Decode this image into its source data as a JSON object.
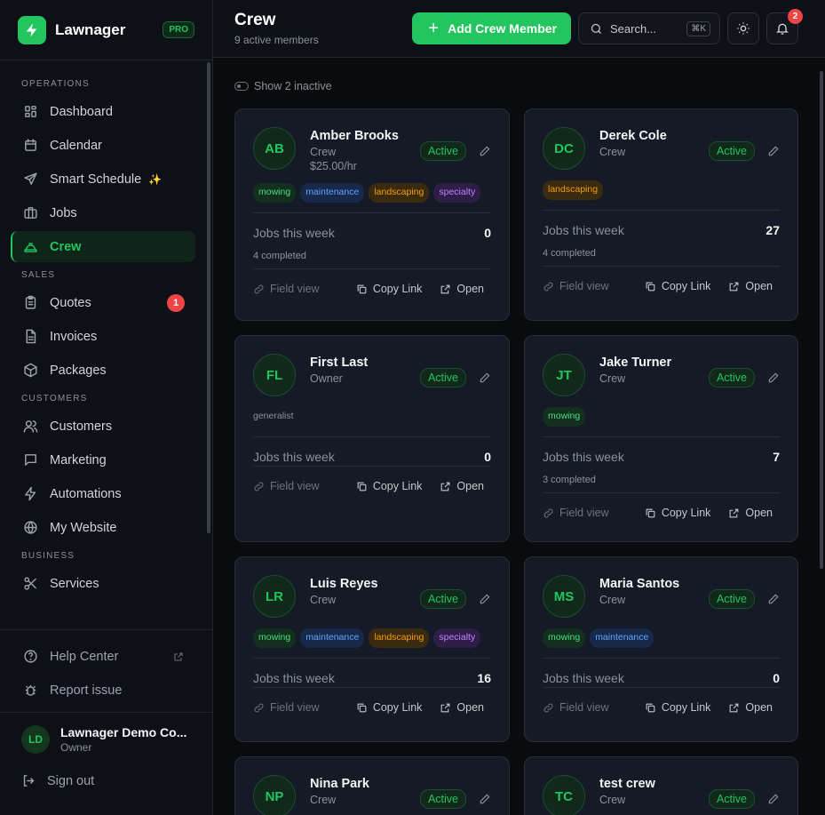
{
  "brand": {
    "name": "Lawnager",
    "badge": "PRO"
  },
  "sidebar": {
    "sections": [
      {
        "label": "OPERATIONS",
        "items": [
          {
            "label": "Dashboard",
            "icon": "grid-icon"
          },
          {
            "label": "Calendar",
            "icon": "calendar-icon"
          },
          {
            "label": "Smart Schedule",
            "icon": "send-icon",
            "sparkle": "✨"
          },
          {
            "label": "Jobs",
            "icon": "briefcase-icon"
          },
          {
            "label": "Crew",
            "icon": "hardhat-icon",
            "active": true
          }
        ]
      },
      {
        "label": "SALES",
        "items": [
          {
            "label": "Quotes",
            "icon": "clipboard-icon",
            "badge": "1"
          },
          {
            "label": "Invoices",
            "icon": "file-icon"
          },
          {
            "label": "Packages",
            "icon": "package-icon"
          }
        ]
      },
      {
        "label": "CUSTOMERS",
        "items": [
          {
            "label": "Customers",
            "icon": "users-icon"
          },
          {
            "label": "Marketing",
            "icon": "message-icon"
          },
          {
            "label": "Automations",
            "icon": "zap-icon"
          },
          {
            "label": "My Website",
            "icon": "globe-icon"
          }
        ]
      },
      {
        "label": "BUSINESS",
        "items": [
          {
            "label": "Services",
            "icon": "scissors-icon"
          }
        ]
      }
    ],
    "help": "Help Center",
    "report": "Report issue",
    "user": {
      "initials": "LD",
      "name": "Lawnager Demo Co...",
      "role": "Owner"
    },
    "signout": "Sign out"
  },
  "header": {
    "title": "Crew",
    "subtitle": "9 active members",
    "add_label": "Add Crew Member",
    "search_placeholder": "Search...",
    "search_kbd": "⌘K",
    "notif_count": "2"
  },
  "toggle_label": "Show 2 inactive",
  "labels": {
    "jobs_week": "Jobs this week",
    "field_view": "Field view",
    "copy_link": "Copy Link",
    "open": "Open"
  },
  "crew": [
    {
      "initials": "AB",
      "name": "Amber Brooks",
      "role": "Crew",
      "rate": "$25.00/hr",
      "status": "Active",
      "tags": [
        "mowing",
        "maintenance",
        "landscaping",
        "specialty"
      ],
      "jobs": "0",
      "completed": "4 completed"
    },
    {
      "initials": "DC",
      "name": "Derek Cole",
      "role": "Crew",
      "status": "Active",
      "tags": [
        "landscaping"
      ],
      "jobs": "27",
      "completed": "4 completed"
    },
    {
      "initials": "FL",
      "name": "First Last",
      "role": "Owner",
      "status": "Active",
      "tags": [
        "generalist"
      ],
      "jobs": "0"
    },
    {
      "initials": "JT",
      "name": "Jake Turner",
      "role": "Crew",
      "status": "Active",
      "tags": [
        "mowing"
      ],
      "jobs": "7",
      "completed": "3 completed"
    },
    {
      "initials": "LR",
      "name": "Luis Reyes",
      "role": "Crew",
      "status": "Active",
      "tags": [
        "mowing",
        "maintenance",
        "landscaping",
        "specialty"
      ],
      "jobs": "16"
    },
    {
      "initials": "MS",
      "name": "Maria Santos",
      "role": "Crew",
      "status": "Active",
      "tags": [
        "mowing",
        "maintenance"
      ],
      "jobs": "0"
    },
    {
      "initials": "NP",
      "name": "Nina Park",
      "role": "Crew",
      "status": "Active",
      "tags": [],
      "jobs": ""
    },
    {
      "initials": "TC",
      "name": "test crew",
      "role": "Crew",
      "status": "Active",
      "tags": [],
      "jobs": ""
    }
  ],
  "colors": {
    "accent": "#22c55e",
    "badge": "#ef4444",
    "bg": "#0a0b0d",
    "card": "#141a26"
  }
}
